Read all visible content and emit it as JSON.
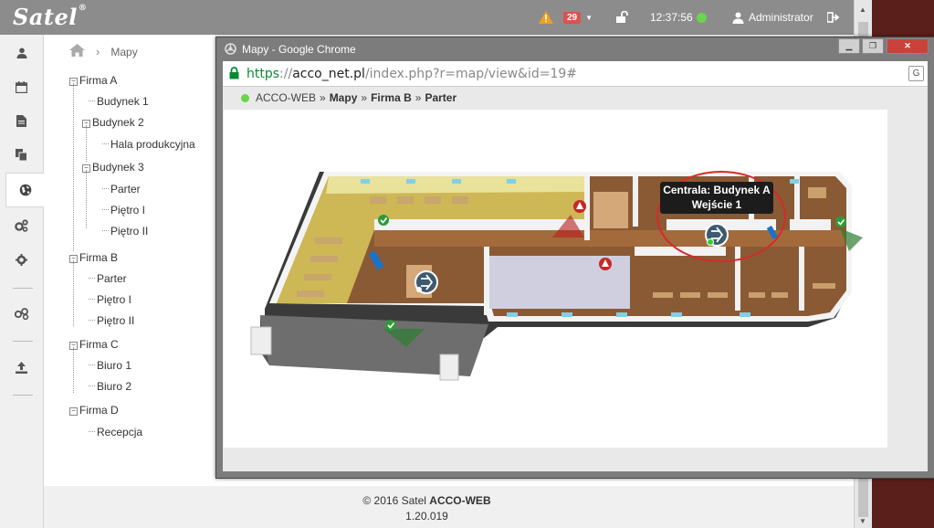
{
  "app": {
    "logo": "Satel",
    "logo_mark": "®",
    "alert_count": "29",
    "time": "12:37:56",
    "user": "Administrator"
  },
  "breadcrumb": {
    "current": "Mapy"
  },
  "tree": [
    {
      "label": "Firma A",
      "type": "expander"
    },
    {
      "label": "Budynek 1",
      "type": "leaf"
    },
    {
      "label": "Budynek 2",
      "type": "expander"
    },
    {
      "label": "Hala produkcyjna",
      "type": "leaf"
    },
    {
      "label": "Budynek 3",
      "type": "expander"
    },
    {
      "label": "Parter",
      "type": "leaf"
    },
    {
      "label": "Piętro I",
      "type": "leaf"
    },
    {
      "label": "Piętro II",
      "type": "leaf"
    },
    {
      "label": "Firma B",
      "type": "expander"
    },
    {
      "label": "Parter",
      "type": "leaf"
    },
    {
      "label": "Piętro I",
      "type": "leaf"
    },
    {
      "label": "Piętro II",
      "type": "leaf"
    },
    {
      "label": "Firma C",
      "type": "expander"
    },
    {
      "label": "Biuro 1",
      "type": "leaf"
    },
    {
      "label": "Biuro 2",
      "type": "leaf"
    },
    {
      "label": "Firma D",
      "type": "expander"
    },
    {
      "label": "Recepcja",
      "type": "leaf"
    }
  ],
  "footer": {
    "copyright": "© 2016 Satel",
    "product": "ACCO-WEB",
    "version": "1.20.019"
  },
  "popup": {
    "title": "Mapy - Google Chrome",
    "url_scheme": "https",
    "url_sep": "://",
    "url_host": "acco_net.pl",
    "url_path": "/index.php?r=map/view&id=19#",
    "crumbs": [
      "ACCO-WEB",
      "Mapy",
      "Firma B",
      "Parter"
    ],
    "crumb_separator": "»",
    "tooltip_line1": "Centrala: Budynek A",
    "tooltip_line2": "Wejście 1"
  },
  "colors": {
    "topbar": "#8c8c8c",
    "alert": "#d9534f",
    "online": "#6cd44c",
    "highlight_ring": "#d62a2a"
  }
}
